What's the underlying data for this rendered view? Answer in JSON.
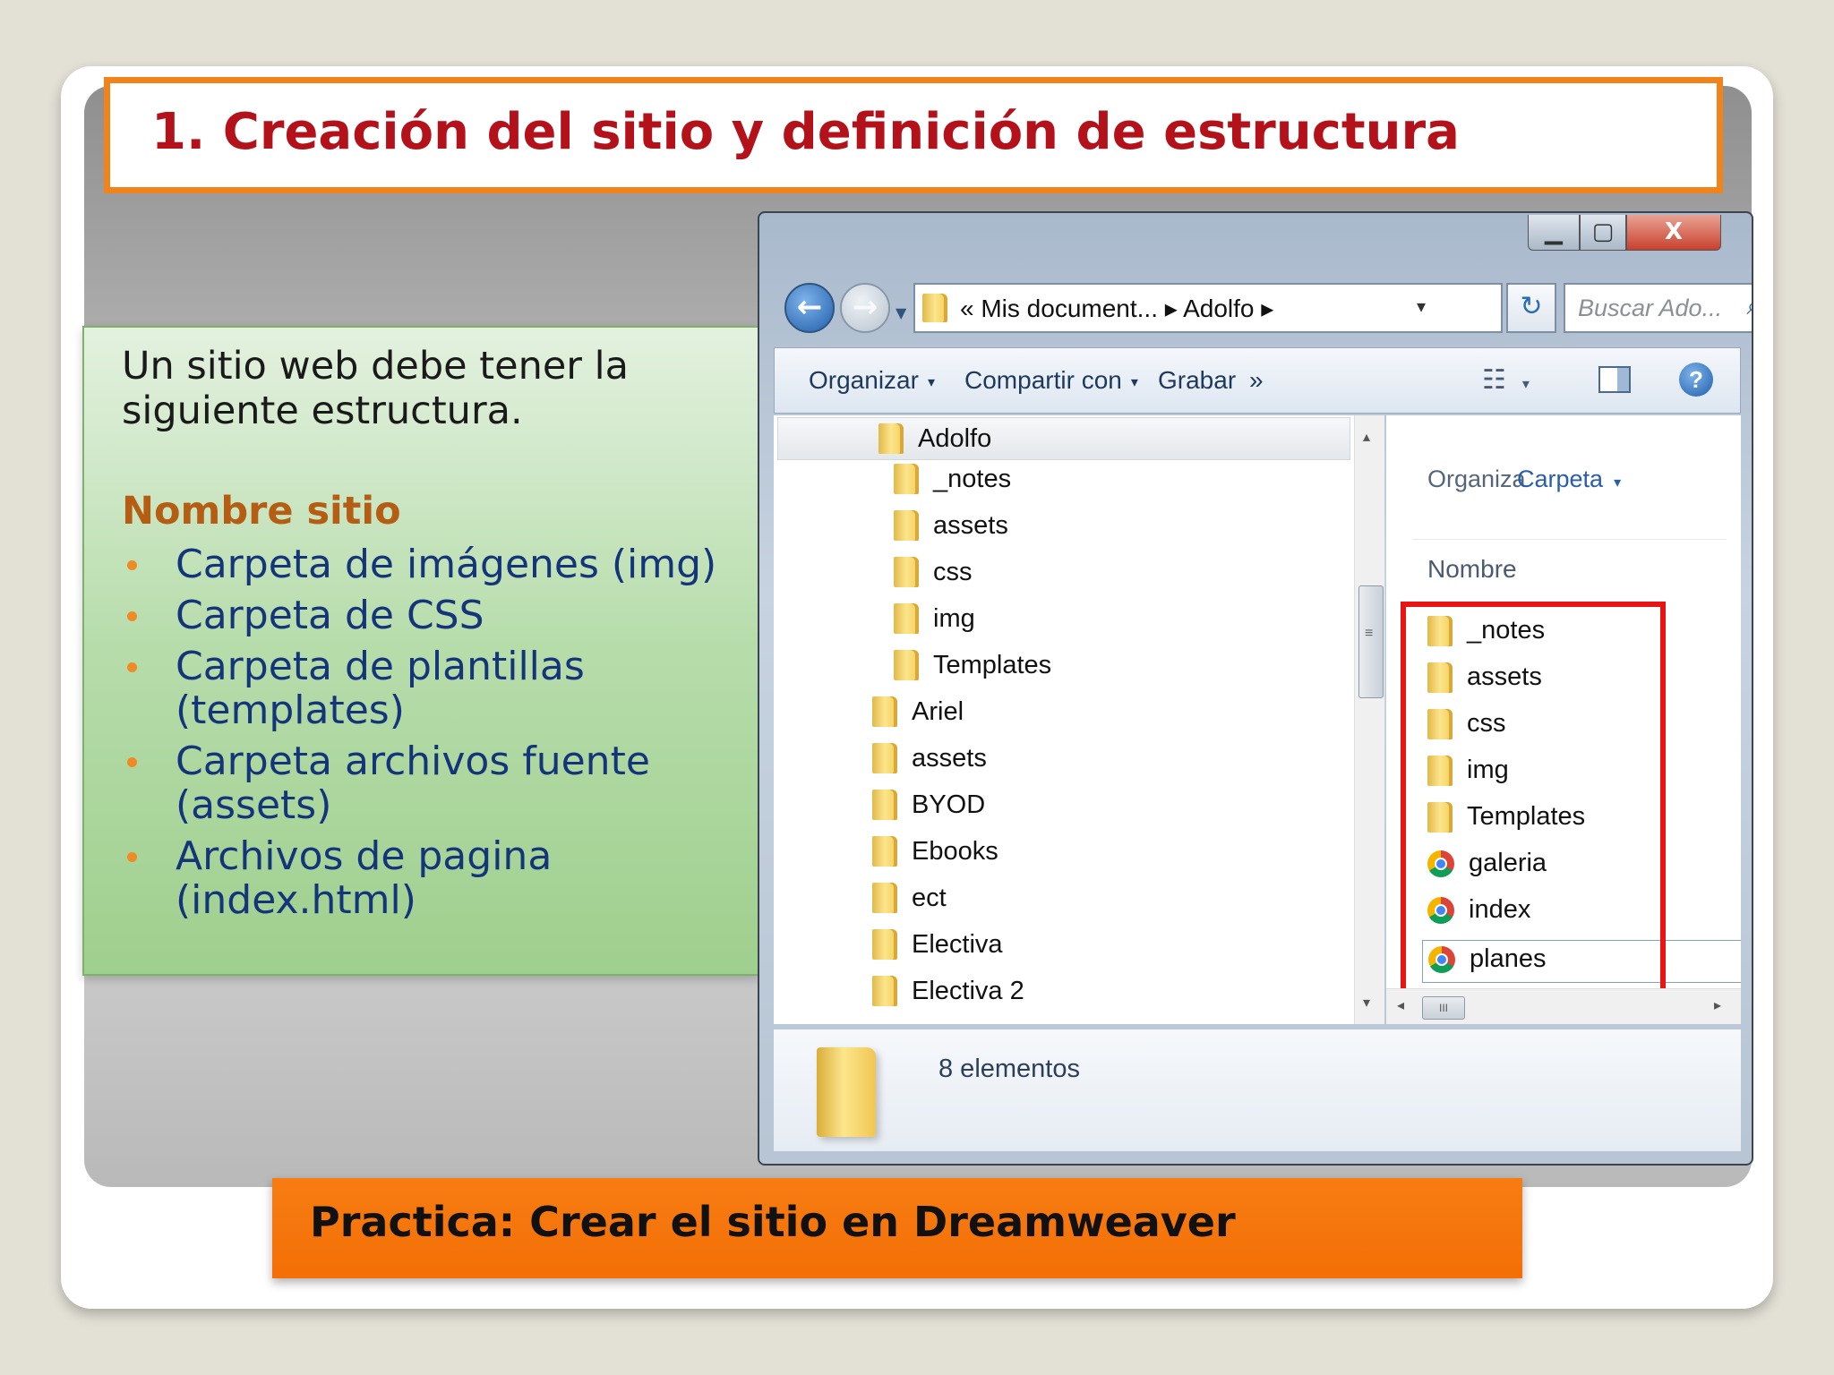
{
  "slide": {
    "title": "1. Creación del sitio y definición de estructura",
    "intro": "Un sitio web debe tener la siguiente estructura.",
    "site_heading": "Nombre sitio",
    "bullets": [
      "Carpeta de imágenes (img)",
      "Carpeta de CSS",
      "Carpeta de plantillas (templates)",
      "Carpeta archivos fuente (assets)",
      "Archivos de pagina (index.html)"
    ],
    "footer": "Practica: Crear el sitio en Dreamweaver"
  },
  "colors": {
    "title_text": "#b3121b",
    "title_border": "#f0841c",
    "heading": "#b55d12",
    "bullet_text": "#15357a",
    "footer_bg": "#f67d12",
    "highlight_box": "#e81515"
  },
  "explorer": {
    "window_controls": {
      "minimize": "▁",
      "maximize": "▢",
      "close": "X"
    },
    "address": {
      "prefix": "«",
      "crumb1": "Mis document...",
      "sep": "▸",
      "crumb2": "Adolfo",
      "dropdown": "▾"
    },
    "refresh_icon": "↻",
    "search_placeholder": "Buscar Ado...",
    "search_icon": "⌕",
    "toolbar": {
      "organizar": "Organizar",
      "compartir": "Compartir con",
      "grabar": "Grabar",
      "more": "»",
      "dropdown": "▾",
      "views_icon": "☷",
      "help": "?"
    },
    "tree": [
      {
        "label": "Adolfo",
        "level": 1,
        "selected": true
      },
      {
        "label": "_notes",
        "level": 2
      },
      {
        "label": "assets",
        "level": 2
      },
      {
        "label": "css",
        "level": 2
      },
      {
        "label": "img",
        "level": 2
      },
      {
        "label": "Templates",
        "level": 2
      },
      {
        "label": "Ariel",
        "level": 1
      },
      {
        "label": "assets",
        "level": 1
      },
      {
        "label": "BYOD",
        "level": 1
      },
      {
        "label": "Ebooks",
        "level": 1
      },
      {
        "label": "ect",
        "level": 1
      },
      {
        "label": "Electiva",
        "level": 1
      },
      {
        "label": "Electiva 2",
        "level": 1
      }
    ],
    "right_pane": {
      "organize_label": "Organiza",
      "arrange_label": "Carpeta",
      "column_header": "Nombre",
      "items": [
        {
          "name": "_notes",
          "type": "folder"
        },
        {
          "name": "assets",
          "type": "folder"
        },
        {
          "name": "css",
          "type": "folder"
        },
        {
          "name": "img",
          "type": "folder"
        },
        {
          "name": "Templates",
          "type": "folder"
        },
        {
          "name": "galeria",
          "type": "html"
        },
        {
          "name": "index",
          "type": "html"
        },
        {
          "name": "planes",
          "type": "html"
        }
      ]
    },
    "scroll": {
      "up": "▴",
      "down": "▾",
      "left": "◂",
      "right": "▸",
      "grip_v": "≡",
      "grip_h": "III"
    },
    "status": "8 elementos"
  }
}
